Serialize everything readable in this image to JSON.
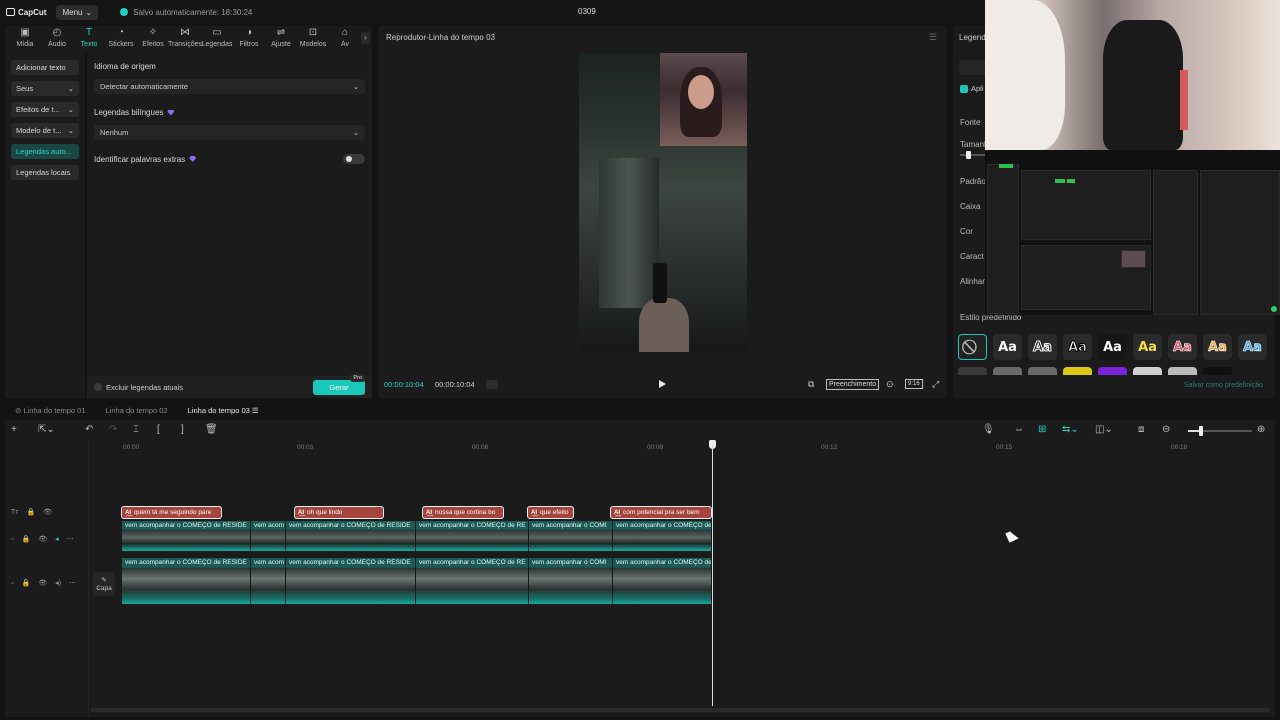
{
  "app": {
    "logo": "CapCut",
    "menu_label": "Menu",
    "saved_status": "Salvo automaticamente: 18:30:24",
    "project_title": "0309"
  },
  "toolbar": {
    "tabs": [
      {
        "label": "Mídia",
        "icon": "media-icon"
      },
      {
        "label": "Áudio",
        "icon": "audio-icon"
      },
      {
        "label": "Texto",
        "icon": "text-icon",
        "active": true
      },
      {
        "label": "Stickers",
        "icon": "sticker-icon"
      },
      {
        "label": "Efeitos",
        "icon": "effects-icon"
      },
      {
        "label": "Transições",
        "icon": "transitions-icon"
      },
      {
        "label": "Legendas",
        "icon": "captions-icon"
      },
      {
        "label": "Filtros",
        "icon": "filters-icon"
      },
      {
        "label": "Ajuste",
        "icon": "adjust-icon"
      },
      {
        "label": "Modelos",
        "icon": "templates-icon"
      },
      {
        "label": "Av",
        "icon": "more-icon"
      }
    ]
  },
  "left_nav": [
    {
      "label": "Adicionar texto",
      "chevron": false
    },
    {
      "label": "Seus",
      "chevron": true
    },
    {
      "label": "Efeitos de t...",
      "chevron": true
    },
    {
      "label": "Modelo de t...",
      "chevron": true
    },
    {
      "label": "Legendas auto...",
      "active": true
    },
    {
      "label": "Legendas locais"
    }
  ],
  "captions_panel": {
    "source_language_label": "Idioma de origem",
    "source_language_value": "Detectar automaticamente",
    "bilingual_label": "Legendas bilíngues",
    "bilingual_value": "Nenhum",
    "extra_words_label": "Identificar palavras extras",
    "extra_words_on": false,
    "delete_current_label": "Excluir legendas atuais",
    "generate_label": "Gerar",
    "pro_badge": "Pro"
  },
  "player": {
    "title": "Reprodutor-Linha do tempo 03",
    "current_time": "00:00:10:04",
    "total_time": "00:00:10:04",
    "fill_label": "Preenchimento",
    "ratio_label": "9:16"
  },
  "right_panel": {
    "title": "Legendas",
    "apply_label": "Apli",
    "labels": {
      "font": "Fonte",
      "size": "Tamanh",
      "pattern": "Padrão",
      "box": "Caixa",
      "color": "Cor",
      "chars": "Caract",
      "align": "Alinham",
      "preset_style": "Estilo predefinido"
    },
    "preset_text": "Aa",
    "presets": [
      {
        "fg": "#ffffff",
        "stroke": "none"
      },
      {
        "fg": "#222222",
        "stroke": "#ffffff"
      },
      {
        "fg": "#ffffff",
        "stroke": "#000000"
      },
      {
        "fg": "#ffffff",
        "stroke": "#111111"
      },
      {
        "fg": "#f4e13a",
        "stroke": "#000000"
      },
      {
        "fg": "#e84a5f",
        "stroke": "#ffffff"
      },
      {
        "fg": "#f7a23e",
        "stroke": "#ffffff"
      },
      {
        "fg": "#3aa5f4",
        "stroke": "#ffffff"
      }
    ],
    "save_preset_label": "Salvar como predefinição"
  },
  "timeline": {
    "tabs": [
      {
        "label": "Linha do tempo 01"
      },
      {
        "label": "Linha do tempo 02"
      },
      {
        "label": "Linha do tempo 03",
        "active": true
      }
    ],
    "ruler": [
      "00:00",
      "00:03",
      "00:06",
      "00:09",
      "00:12",
      "00:15",
      "00:18"
    ],
    "cover_label": "Capa",
    "subtitle_clips": [
      {
        "text": "quem tá me seguindo pare"
      },
      {
        "text": "oh que lindo"
      },
      {
        "text": "nossa que cortina bo"
      },
      {
        "text": "que efeito"
      },
      {
        "text": "com potencial pra ser bem"
      }
    ],
    "video_clips_top": [
      "vem acompanhar o COMEÇO de RESIDE",
      "vem acom",
      "vem acompanhar o COMEÇO de RESIDE",
      "vem acompanhar o COMEÇO de RE",
      "vem acompanhar o COMI",
      "vem acompanhar o COMEÇO de"
    ],
    "video_clips_bottom": [
      "vem acompanhar o COMEÇO de RESIDE",
      "vem acom",
      "vem acompanhar o COMEÇO de RESIDE",
      "vem acompanhar o COMEÇO de RE",
      "vem acompanhar o COMI",
      "vem acompanhar o COMEÇO de"
    ]
  },
  "colors": {
    "accent": "#19d6c6",
    "subtitle_clip": "#a4443d",
    "video_track": "#0f3e3c"
  }
}
